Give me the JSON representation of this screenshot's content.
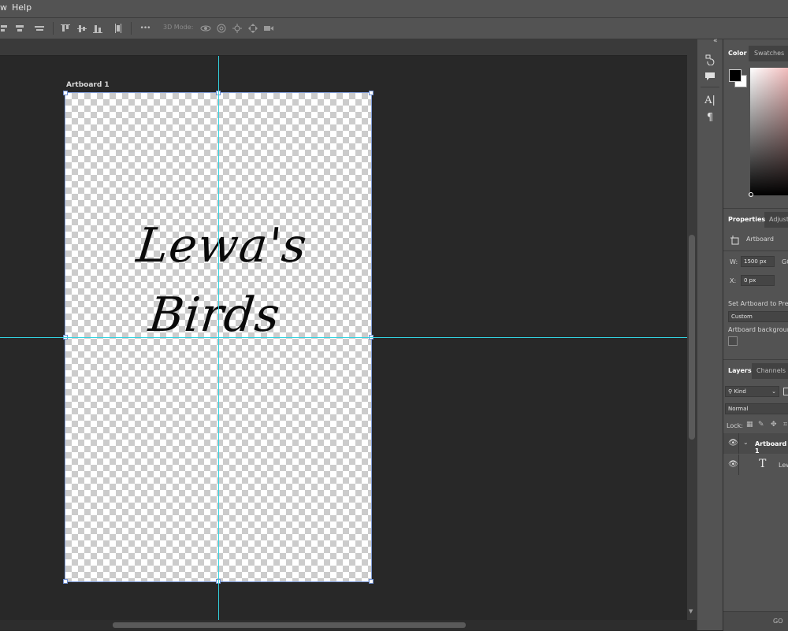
{
  "menubar": {
    "items": [
      "w",
      "Help"
    ]
  },
  "options_bar": {
    "mode_label": "3D Mode:",
    "more_label": "•••",
    "icons": [
      "align-left-edges-icon",
      "align-horizontal-centers-icon",
      "align-right-edges-icon",
      "align-top-edges-icon",
      "align-vertical-centers-icon",
      "align-bottom-edges-icon",
      "distribute-icon",
      "orbit-3d-icon",
      "roll-3d-icon",
      "pan-3d-icon",
      "slide-3d-icon",
      "scale-3d-icon"
    ]
  },
  "canvas": {
    "artboard_label": "Artboard 1",
    "text_line1": "Lewa's",
    "text_line2": "Birds",
    "guide_color": "#33d2e0"
  },
  "dock": {
    "collapse_label": "«",
    "icons": [
      "history-icon",
      "comments-icon",
      "character-icon",
      "paragraph-icon"
    ]
  },
  "color_panel": {
    "tabs": [
      "Color",
      "Swatches"
    ],
    "active_tab": "Color",
    "foreground": "#000000",
    "background": "#ffffff"
  },
  "properties_panel": {
    "tabs": [
      "Properties",
      "Adjust"
    ],
    "active_tab": "Properties",
    "type_label": "Artboard",
    "width_label": "W:",
    "width_value": "1500 px",
    "go_label": "GO",
    "x_label": "X:",
    "x_value": "0 px",
    "preset_label": "Set Artboard to Preset",
    "preset_value": "Custom",
    "background_label": "Artboard background"
  },
  "layers_panel": {
    "tabs": [
      "Layers",
      "Channels"
    ],
    "active_tab": "Layers",
    "filter_value": "Kind",
    "blend_mode": "Normal",
    "lock_label": "Lock:",
    "layers": [
      {
        "name": "Artboard 1",
        "kind": "artboard"
      },
      {
        "name": "Lew",
        "kind": "text"
      }
    ],
    "footer_icon_label": "GO"
  }
}
